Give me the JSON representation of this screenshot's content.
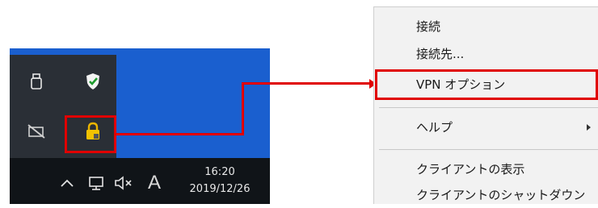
{
  "colors": {
    "desktop": "#1a5fcf",
    "overflow_panel": "#2a2f36",
    "taskbar": "#101418",
    "highlight": "#e00000",
    "menu_bg": "#f2f2f2"
  },
  "tray_overflow": {
    "icons": [
      "usb-device-icon",
      "windows-security-shield-icon",
      "network-disconnected-icon",
      "vpn-lock-icon"
    ]
  },
  "taskbar": {
    "chevron": "^",
    "icons": [
      "show-hidden-icons-chevron-icon",
      "network-icon",
      "volume-muted-icon",
      "ime-mode-icon"
    ],
    "ime_mode": "A",
    "time": "16:20",
    "date": "2019/12/26"
  },
  "context_menu": {
    "items": [
      {
        "label": "接続"
      },
      {
        "label": "接続先..."
      },
      {
        "label": "VPN オプション"
      },
      {
        "label": "ヘルプ",
        "submenu": true
      },
      {
        "label": "クライアントの表示"
      },
      {
        "label": "クライアントのシャットダウン"
      }
    ]
  }
}
